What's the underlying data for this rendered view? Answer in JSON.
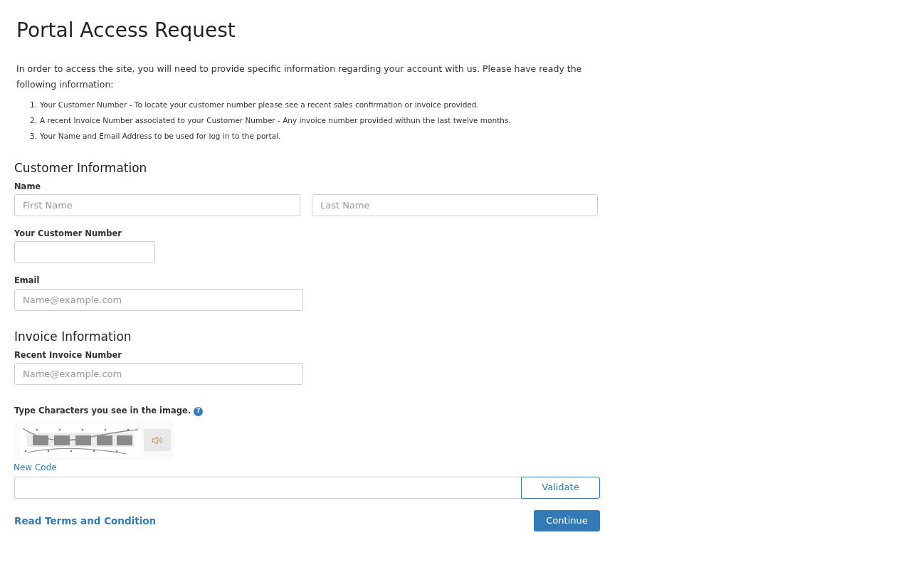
{
  "title": "Portal Access Request",
  "intro": "In order to access the site, you will need to provide specific information regarding your account with us. Please have ready the following information:",
  "requirements": [
    {
      "marker": "1.",
      "text": "Your Customer Number - To locate your customer number please see a recent sales confirmation or invoice provided."
    },
    {
      "marker": "2.",
      "text": "A recent Invoice Number associated to your Customer Number - Any invoice number provided withun the last twelve months."
    },
    {
      "marker": "3.",
      "text": "Your Name and Email Address to be used for log in to the portal."
    }
  ],
  "customer_section": {
    "heading": "Customer Information",
    "name_label": "Name",
    "first_name": {
      "placeholder": "First Name"
    },
    "last_name": {
      "placeholder": "Last Name"
    },
    "customer_number_label": "Your Customer Number",
    "email_label": "Email",
    "email": {
      "placeholder": "Name@example.com"
    }
  },
  "invoice_section": {
    "heading": "Invoice Information",
    "invoice_label": "Recent Invoice Number",
    "invoice": {
      "placeholder": "Name@example.com"
    }
  },
  "captcha": {
    "label": "Type Characters you see in the image.",
    "help_icon": "?",
    "new_code": "New Code",
    "validate": "Validate"
  },
  "terms_link": "Read Terms and Condition",
  "continue": "Continue"
}
